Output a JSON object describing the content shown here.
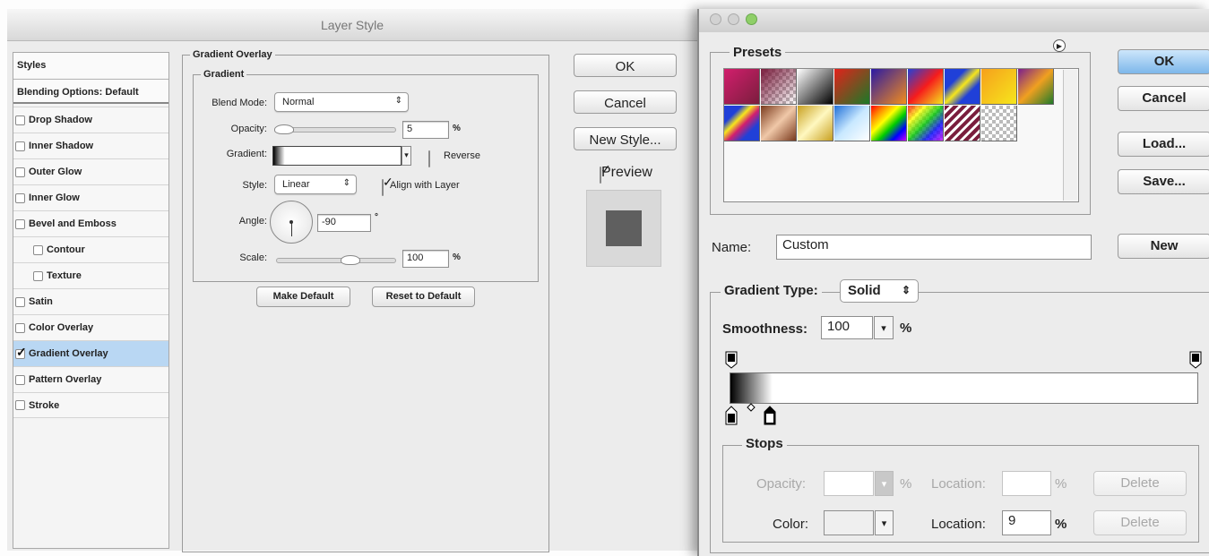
{
  "layer_style": {
    "title": "Layer Style",
    "sidebar": {
      "header": "Styles",
      "blending": "Blending Options: Default",
      "items": [
        {
          "label": "Drop Shadow",
          "checked": false
        },
        {
          "label": "Inner Shadow",
          "checked": false
        },
        {
          "label": "Outer Glow",
          "checked": false
        },
        {
          "label": "Inner Glow",
          "checked": false
        },
        {
          "label": "Bevel and Emboss",
          "checked": false
        },
        {
          "label": "Contour",
          "checked": false
        },
        {
          "label": "Texture",
          "checked": false
        },
        {
          "label": "Satin",
          "checked": false
        },
        {
          "label": "Color Overlay",
          "checked": false
        },
        {
          "label": "Gradient Overlay",
          "checked": true
        },
        {
          "label": "Pattern Overlay",
          "checked": false
        },
        {
          "label": "Stroke",
          "checked": false
        }
      ]
    },
    "panel": {
      "section_title": "Gradient Overlay",
      "group_title": "Gradient",
      "blend_mode_label": "Blend Mode:",
      "blend_mode_value": "Normal",
      "opacity_label": "Opacity:",
      "opacity_value": "5",
      "opacity_unit": "%",
      "gradient_label": "Gradient:",
      "reverse_label": "Reverse",
      "style_label": "Style:",
      "style_value": "Linear",
      "align_label": "Align with Layer",
      "angle_label": "Angle:",
      "angle_value": "-90",
      "angle_unit": "°",
      "scale_label": "Scale:",
      "scale_value": "100",
      "scale_unit": "%",
      "make_default": "Make Default",
      "reset_default": "Reset to Default"
    },
    "buttons": {
      "ok": "OK",
      "cancel": "Cancel",
      "new_style": "New Style...",
      "preview": "Preview"
    }
  },
  "gradient_editor": {
    "presets_label": "Presets",
    "buttons": {
      "ok": "OK",
      "cancel": "Cancel",
      "load": "Load...",
      "save": "Save...",
      "new": "New"
    },
    "name_label": "Name:",
    "name_value": "Custom",
    "gradient_type_label": "Gradient Type:",
    "gradient_type_value": "Solid",
    "smoothness_label": "Smoothness:",
    "smoothness_value": "100",
    "smoothness_unit": "%",
    "stops": {
      "title": "Stops",
      "opacity_label": "Opacity:",
      "opacity_unit": "%",
      "location_label": "Location:",
      "location_unit": "%",
      "delete_label": "Delete",
      "color_label": "Color:",
      "color_location_value": "9"
    }
  },
  "colors": {
    "selected_bg": "#b9d7f3",
    "default_button": "#7db7ea",
    "preview_swatch": "#5f5f5f"
  }
}
